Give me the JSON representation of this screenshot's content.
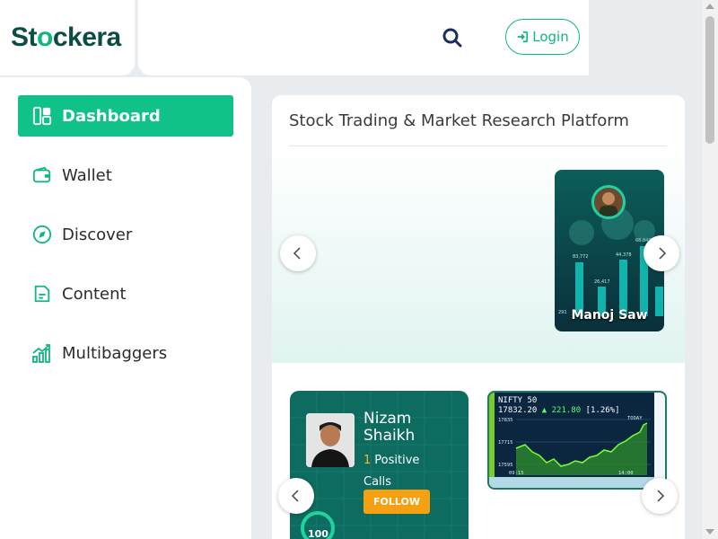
{
  "brand": {
    "name_pre": "St",
    "name_o": "o",
    "name_post": "ckera"
  },
  "header": {
    "login_label": "Login"
  },
  "sidebar": {
    "items": [
      {
        "label": "Dashboard",
        "icon": "dashboard-icon",
        "active": true
      },
      {
        "label": "Wallet",
        "icon": "wallet-icon"
      },
      {
        "label": "Discover",
        "icon": "compass-icon"
      },
      {
        "label": "Content",
        "icon": "document-icon"
      },
      {
        "label": "Multibaggers",
        "icon": "growth-chart-icon"
      }
    ]
  },
  "main": {
    "title": "Stock Trading & Market Research Platform",
    "trader_card": {
      "name": "Manoj Saw"
    },
    "promo_card": {
      "name": "Nizam Shaikh",
      "calls_count": "1",
      "calls_label_1": "Positive",
      "calls_label_2": "Calls",
      "follow_label": "FOLLOW",
      "score": "100"
    },
    "chart_card": {
      "index_name": "NIFTY 50",
      "index_value": "17832.20",
      "change": "▲ 221.80",
      "change_pct": "[1.26%]"
    }
  },
  "colors": {
    "accent": "#10c28a",
    "brand_dark": "#0b4d45",
    "follow": "#f5a011"
  }
}
